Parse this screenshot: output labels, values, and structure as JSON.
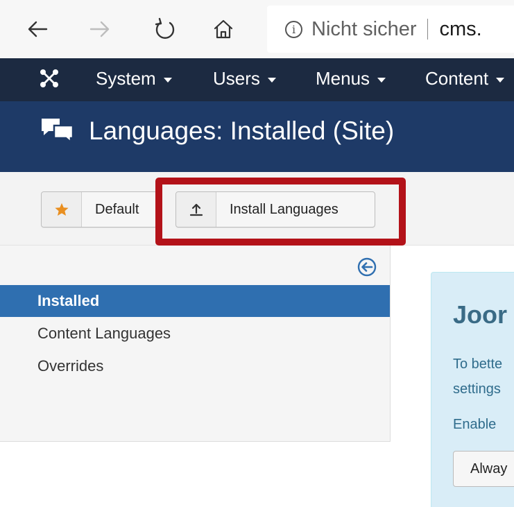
{
  "browser": {
    "insecure_label": "Nicht sicher",
    "url": "cms."
  },
  "topnav": {
    "items": [
      {
        "label": "System"
      },
      {
        "label": "Users"
      },
      {
        "label": "Menus"
      },
      {
        "label": "Content"
      }
    ]
  },
  "header": {
    "title": "Languages: Installed (Site)"
  },
  "toolbar": {
    "default_label": "Default",
    "install_label": "Install Languages"
  },
  "sidebar": {
    "items": [
      {
        "label": "Installed",
        "active": true
      },
      {
        "label": "Content Languages",
        "active": false
      },
      {
        "label": "Overrides",
        "active": false
      }
    ]
  },
  "message": {
    "heading": "Joor",
    "line1": "To bette",
    "line2": "settings",
    "line3": "Enable",
    "button_label": "Alway"
  },
  "colors": {
    "topnav_bg": "#1c2a41",
    "header_bg": "#1e3a67",
    "sidebar_active": "#2f6fb0",
    "highlight_border": "#b31219",
    "star": "#e98f20",
    "message_bg": "#d9edf7"
  }
}
